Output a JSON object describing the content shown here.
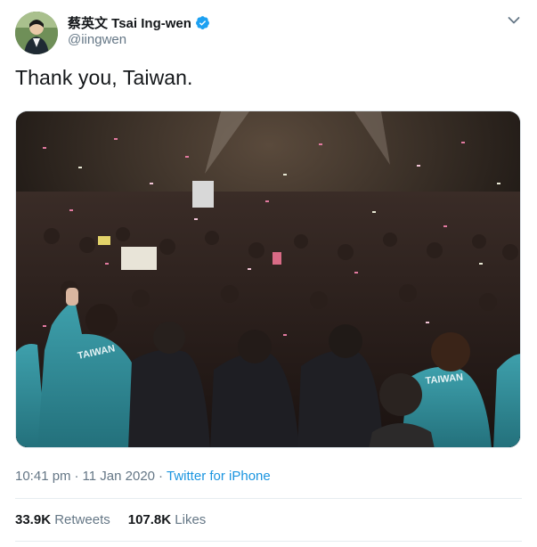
{
  "author": {
    "display_name": "蔡英文 Tsai Ing-wen",
    "handle": "@iingwen",
    "verified_icon": "verified-badge-icon"
  },
  "tweet": {
    "text": "Thank you, Taiwan.",
    "image_text": {
      "jacket_left": "TAIWAN",
      "jacket_right": "TAIWAN"
    }
  },
  "meta": {
    "time": "10:41 pm",
    "separator": "·",
    "date": "11 Jan 2020",
    "source": "Twitter for iPhone"
  },
  "stats": {
    "retweets_count": "33.9K",
    "retweets_label": "Retweets",
    "likes_count": "107.8K",
    "likes_label": "Likes"
  },
  "colors": {
    "link": "#1b95e0",
    "muted": "#657786",
    "verified": "#1da1f2",
    "jacket": "#2f8f9c"
  }
}
